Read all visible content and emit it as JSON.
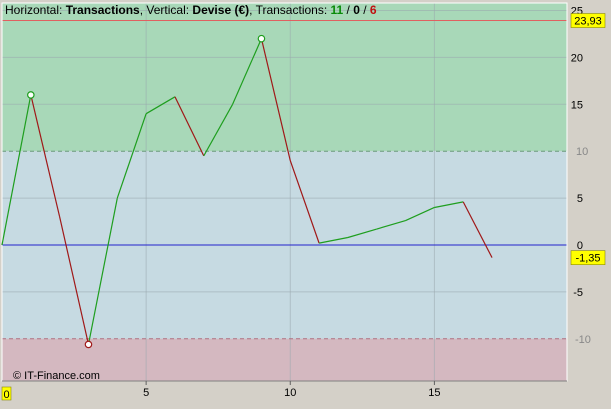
{
  "header": {
    "horizontal_prefix": "Horizontal: ",
    "horizontal_value": "Transactions",
    "vertical_prefix": ", Vertical: ",
    "vertical_value": "Devise (€)",
    "transactions_prefix": ", Transactions: ",
    "count_wins": "11",
    "sep1": " / ",
    "count_neutral": "0",
    "sep2": " / ",
    "count_losses": "6"
  },
  "watermark": "© IT-Finance.com",
  "chart_data": {
    "type": "line",
    "xlim": [
      0,
      19.6
    ],
    "ylim": [
      -14.5,
      25.8
    ],
    "x_ticks": [
      5,
      10,
      15
    ],
    "x_tick_labels": [
      "5",
      "10",
      "15"
    ],
    "x_origin_label": "0",
    "y_ticks": [
      -5,
      0,
      5,
      15,
      20,
      25
    ],
    "y_tick_labels": [
      "-5",
      "0",
      "5",
      "15",
      "20",
      "25"
    ],
    "grid": true,
    "zones": {
      "upper_threshold": 10,
      "upper_threshold_label": "10",
      "lower_threshold": -10,
      "lower_threshold_label": "-10",
      "max_value": 23.93,
      "max_value_label": "23,93",
      "current_value": -1.35,
      "current_value_label": "-1,35"
    },
    "points": [
      {
        "x": 0,
        "y": 0
      },
      {
        "x": 1,
        "y": 16
      },
      {
        "x": 2,
        "y": 3
      },
      {
        "x": 3,
        "y": -10.6
      },
      {
        "x": 4,
        "y": 5
      },
      {
        "x": 5,
        "y": 14
      },
      {
        "x": 6,
        "y": 15.8
      },
      {
        "x": 7,
        "y": 9.5
      },
      {
        "x": 8,
        "y": 15
      },
      {
        "x": 9,
        "y": 22
      },
      {
        "x": 10,
        "y": 9
      },
      {
        "x": 11,
        "y": 0.2
      },
      {
        "x": 12,
        "y": 0.8
      },
      {
        "x": 13,
        "y": 1.7
      },
      {
        "x": 14,
        "y": 2.6
      },
      {
        "x": 15,
        "y": 4
      },
      {
        "x": 16,
        "y": 4.6
      },
      {
        "x": 17,
        "y": -1.35
      }
    ],
    "markers": [
      {
        "x": 1,
        "y": 16,
        "kind": "peak"
      },
      {
        "x": 3,
        "y": -10.6,
        "kind": "trough"
      },
      {
        "x": 9,
        "y": 22,
        "kind": "peak"
      }
    ],
    "colors": {
      "up": "#1e9e1e",
      "down": "#a01818",
      "zero_line": "#2222cc",
      "upper_zone": "#a8d8b8",
      "mid_zone": "#c6dae2",
      "lower_zone": "#d4b8c0",
      "max_line": "#e06060",
      "frame": "#ffffff",
      "bg": "#d4d0c8",
      "wins_text": "#0a8a0a",
      "losses_text": "#c01010",
      "label_box": "#ffff00",
      "threshold_label": "#888888"
    }
  }
}
